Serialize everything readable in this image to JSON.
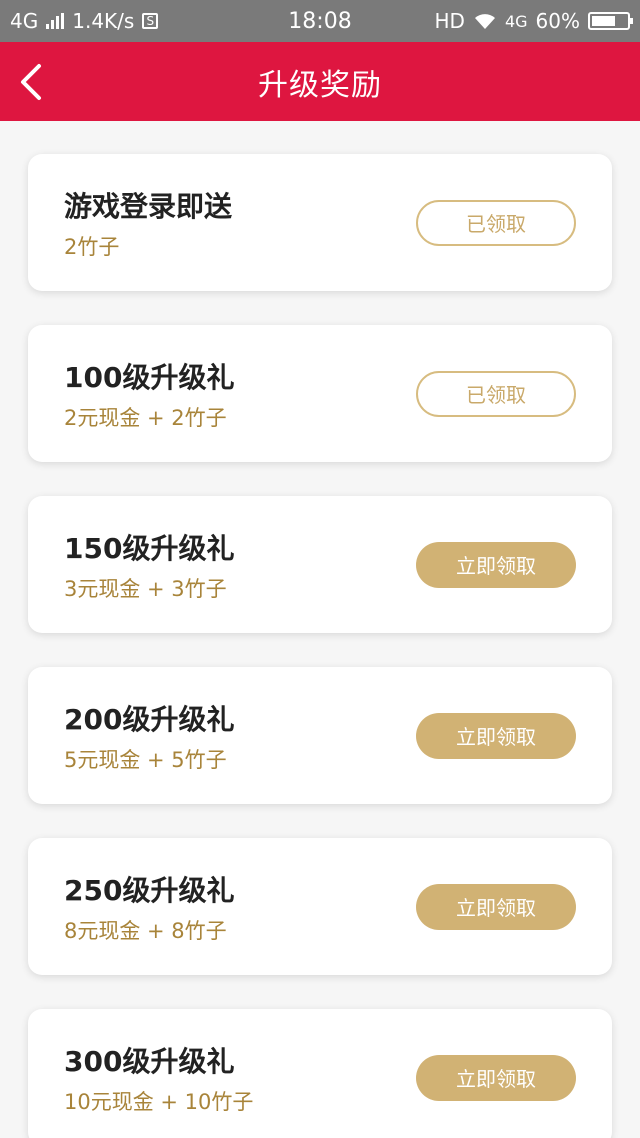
{
  "status_bar": {
    "network": "4G",
    "speed": "1.4K/s",
    "s_icon": "S",
    "time": "18:08",
    "hd": "HD",
    "network2": "4G",
    "battery": "60%"
  },
  "header": {
    "title": "升级奖励",
    "back_icon": "chevron-left-icon"
  },
  "rewards": [
    {
      "title": "游戏登录即送",
      "subtitle": "2竹子",
      "button": "已领取",
      "state": "claimed"
    },
    {
      "title": "100级升级礼",
      "subtitle": "2元现金 + 2竹子",
      "button": "已领取",
      "state": "claimed"
    },
    {
      "title": "150级升级礼",
      "subtitle": "3元现金 + 3竹子",
      "button": "立即领取",
      "state": "claim"
    },
    {
      "title": "200级升级礼",
      "subtitle": "5元现金 + 5竹子",
      "button": "立即领取",
      "state": "claim"
    },
    {
      "title": "250级升级礼",
      "subtitle": "8元现金 + 8竹子",
      "button": "立即领取",
      "state": "claim"
    },
    {
      "title": "300级升级礼",
      "subtitle": "10元现金 + 10竹子",
      "button": "立即领取",
      "state": "claim"
    }
  ],
  "colors": {
    "header_bg": "#de1640",
    "accent_gold": "#d1b274",
    "subtitle_gold": "#a8843a"
  }
}
